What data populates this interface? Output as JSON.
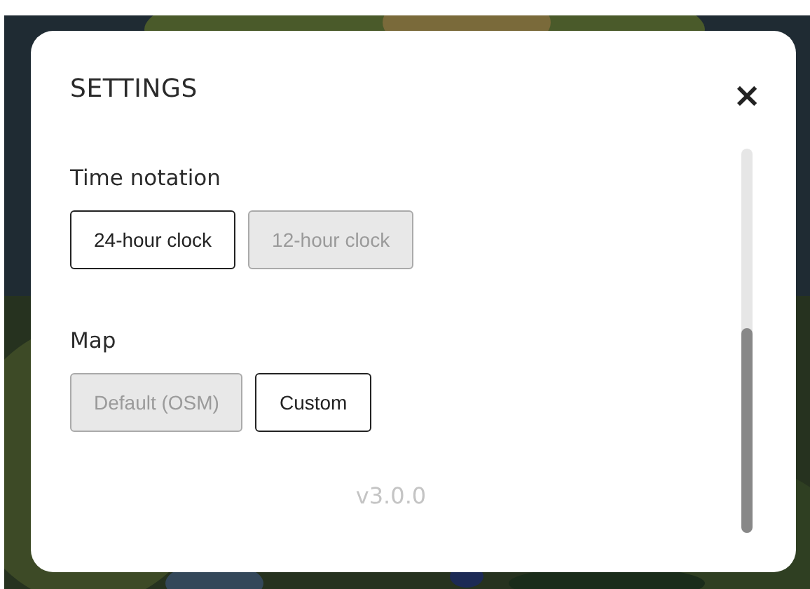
{
  "dialog": {
    "title": "SETTINGS",
    "close": "×"
  },
  "sections": [
    {
      "heading": "Time notation",
      "options": [
        {
          "label": "24-hour clock",
          "selected": true
        },
        {
          "label": "12-hour clock",
          "selected": false
        }
      ]
    },
    {
      "heading": "Map",
      "options": [
        {
          "label": "Default (OSM)",
          "selected": false
        },
        {
          "label": "Custom",
          "selected": true
        }
      ]
    }
  ],
  "version": "v3.0.0"
}
